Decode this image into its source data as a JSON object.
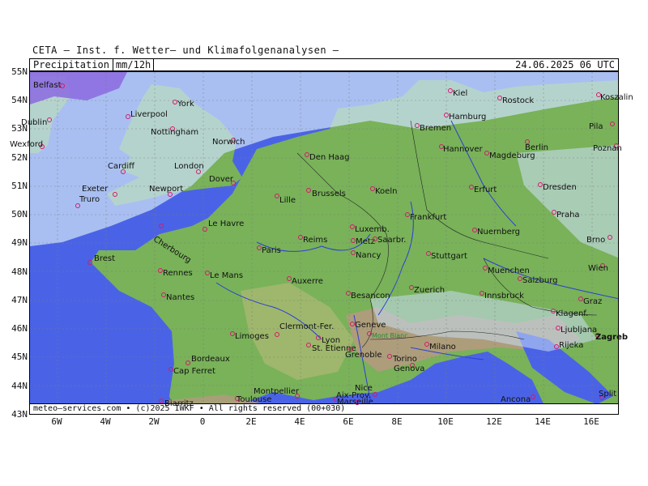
{
  "header": {
    "title": "CETA — Inst. f. Wetter— und Klimafolgenanalysen —"
  },
  "infobar": {
    "parameter": "Precipitation",
    "unit": "mm/12h",
    "datetime": "24.06.2025 06 UTC"
  },
  "footer": {
    "copyright": "meteo—services.com • (c)2025 IWKF • All rights reserved (00+030)"
  },
  "axes": {
    "lat_labels": [
      "55N",
      "54N",
      "53N",
      "52N",
      "51N",
      "50N",
      "49N",
      "48N",
      "47N",
      "46N",
      "45N",
      "44N",
      "43N"
    ],
    "lon_labels": [
      "6W",
      "4W",
      "2W",
      "0",
      "2E",
      "4E",
      "6E",
      "8E",
      "10E",
      "12E",
      "14E",
      "16E"
    ]
  },
  "colors": {
    "sea": "#4a63e6",
    "lowland": "#79b259",
    "hills": "#a8b870",
    "mountain": "#b39a7e",
    "rain_light": "#c9ddf4",
    "rain_heavy": "#8c68e0",
    "city_marker": "#d21a6a",
    "river": "#2a3fd6"
  },
  "cities": [
    {
      "name": "Belfast"
    },
    {
      "name": "York"
    },
    {
      "name": "Dublin"
    },
    {
      "name": "Liverpool"
    },
    {
      "name": "Nottingham"
    },
    {
      "name": "Norwich"
    },
    {
      "name": "Wexford"
    },
    {
      "name": "Cardiff"
    },
    {
      "name": "London"
    },
    {
      "name": "Dover"
    },
    {
      "name": "Exeter"
    },
    {
      "name": "Newport"
    },
    {
      "name": "Truro"
    },
    {
      "name": "Den Haag"
    },
    {
      "name": "Brussels"
    },
    {
      "name": "Lille"
    },
    {
      "name": "Koeln"
    },
    {
      "name": "Le Havre"
    },
    {
      "name": "Luxemb."
    },
    {
      "name": "Frankfurt"
    },
    {
      "name": "Cherbourg"
    },
    {
      "name": "Reims"
    },
    {
      "name": "Metz"
    },
    {
      "name": "Saarbr."
    },
    {
      "name": "Paris"
    },
    {
      "name": "Nancy"
    },
    {
      "name": "Stuttgart"
    },
    {
      "name": "Brest"
    },
    {
      "name": "Rennes"
    },
    {
      "name": "Le Mans"
    },
    {
      "name": "Auxerre"
    },
    {
      "name": "Nantes"
    },
    {
      "name": "Besancon"
    },
    {
      "name": "Zuerich"
    },
    {
      "name": "Limoges"
    },
    {
      "name": "Clermont-Fer."
    },
    {
      "name": "Lyon"
    },
    {
      "name": "Geneve"
    },
    {
      "name": "Mont Blanc"
    },
    {
      "name": "St. Etienne"
    },
    {
      "name": "Grenoble"
    },
    {
      "name": "Torino"
    },
    {
      "name": "Genova"
    },
    {
      "name": "Milano"
    },
    {
      "name": "Bordeaux"
    },
    {
      "name": "Cap Ferret"
    },
    {
      "name": "Montpellier"
    },
    {
      "name": "Aix-Prov."
    },
    {
      "name": "Nice"
    },
    {
      "name": "Marseille"
    },
    {
      "name": "Toulouse"
    },
    {
      "name": "Biarritz"
    },
    {
      "name": "Kiel"
    },
    {
      "name": "Rostock"
    },
    {
      "name": "Koszalin"
    },
    {
      "name": "Hamburg"
    },
    {
      "name": "Bremen"
    },
    {
      "name": "Pila"
    },
    {
      "name": "Hannover"
    },
    {
      "name": "Berlin"
    },
    {
      "name": "Magdeburg"
    },
    {
      "name": "Poznan"
    },
    {
      "name": "Erfurt"
    },
    {
      "name": "Dresden"
    },
    {
      "name": "Praha"
    },
    {
      "name": "Nuernberg"
    },
    {
      "name": "Brno"
    },
    {
      "name": "Muenchen"
    },
    {
      "name": "Wien"
    },
    {
      "name": "Salzburg"
    },
    {
      "name": "Innsbruck"
    },
    {
      "name": "Graz"
    },
    {
      "name": "Klagenf."
    },
    {
      "name": "Ljubljana"
    },
    {
      "name": "Zagreb"
    },
    {
      "name": "Rijeka"
    },
    {
      "name": "Ancona"
    },
    {
      "name": "Split"
    }
  ]
}
